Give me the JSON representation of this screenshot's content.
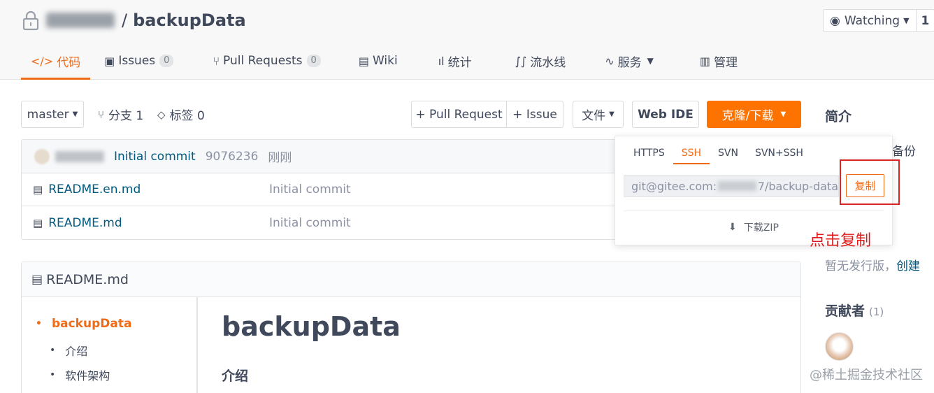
{
  "repo": {
    "name": "backupData",
    "separator": "/"
  },
  "watch": {
    "label": "Watching",
    "count": "1"
  },
  "nav": [
    {
      "icon": "</>",
      "label": "代码",
      "badge": ""
    },
    {
      "icon": "▣",
      "label": "Issues",
      "badge": "0"
    },
    {
      "icon": "⑂",
      "label": "Pull Requests",
      "badge": "0"
    },
    {
      "icon": "▤",
      "label": "Wiki",
      "badge": ""
    },
    {
      "icon": "ıl",
      "label": "统计",
      "badge": ""
    },
    {
      "icon": "∫∫",
      "label": "流水线",
      "badge": ""
    },
    {
      "icon": "∿",
      "label": "服务",
      "badge": ""
    },
    {
      "icon": "▥",
      "label": "管理",
      "badge": ""
    }
  ],
  "toolbar": {
    "branch": "master",
    "branches": "分支 1",
    "tags": "标签 0",
    "pull_request": "+ Pull Request",
    "issue": "+ Issue",
    "file": "文件",
    "web_ide": "Web IDE",
    "clone": "克隆/下载"
  },
  "commit": {
    "message": "Initial commit",
    "hash": "9076236",
    "time": "刚刚"
  },
  "files": [
    {
      "name": "README.en.md",
      "message": "Initial commit"
    },
    {
      "name": "README.md",
      "message": "Initial commit"
    }
  ],
  "readme": {
    "filename": "README.md",
    "toc": [
      "backupData",
      "介绍",
      "软件架构"
    ],
    "h1": "backupData",
    "h2": "介绍"
  },
  "clone_dropdown": {
    "tabs": [
      "HTTPS",
      "SSH",
      "SVN",
      "SVN+SSH"
    ],
    "url_prefix": "git@gitee.com:",
    "url_suffix": "7/backup-data",
    "copy": "复制",
    "download_zip": "下载ZIP"
  },
  "annotation": {
    "label": "点击复制"
  },
  "sidebar": {
    "intro_title": "简介",
    "intro_partial": "备份",
    "release_text": "暂无发行版，",
    "release_link": "创建",
    "contributors_title": "贡献者",
    "contributors_count": "(1)"
  },
  "watermark": "@稀土掘金技术社区",
  "colors": {
    "accent": "#fe7300",
    "link": "#005980",
    "muted": "#8c92a4",
    "annotation": "#e21818"
  }
}
